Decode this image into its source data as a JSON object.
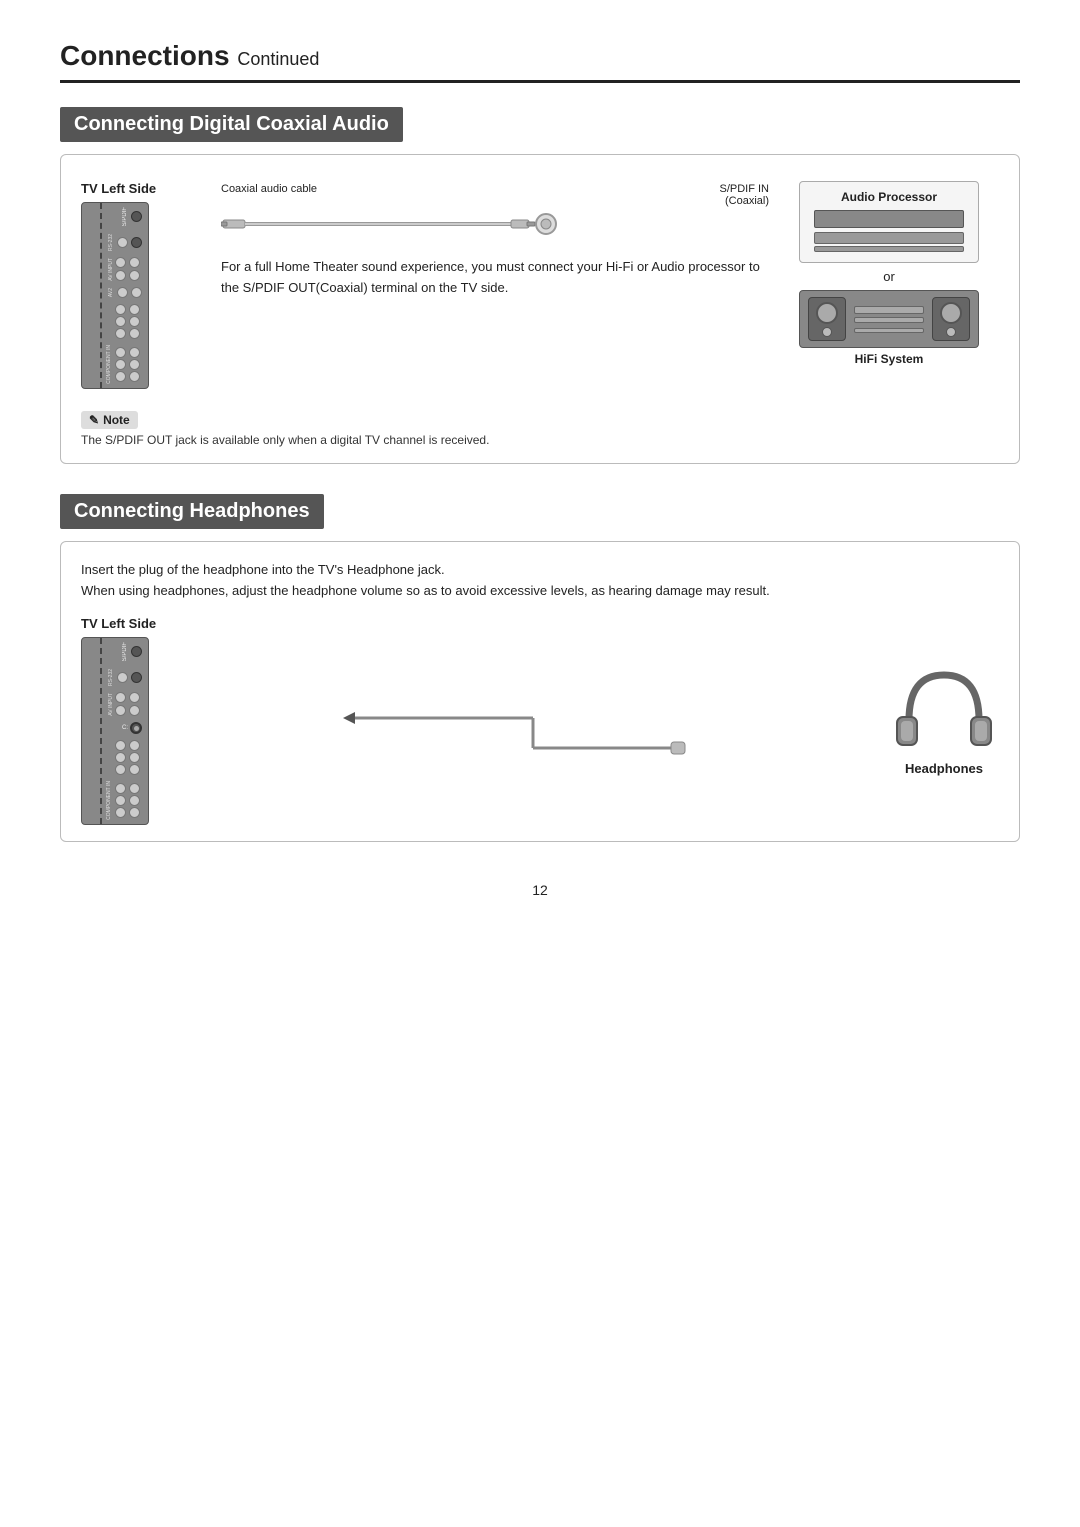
{
  "page": {
    "title": "Connections",
    "title_continued": "Continued",
    "page_number": "12"
  },
  "coaxial_section": {
    "header": "Connecting Digital Coaxial Audio",
    "tv_side_label": "TV Left Side",
    "cable_label": "Coaxial audio cable",
    "spdif_in_label": "S/PDIF IN",
    "coaxial_label": "(Coaxial)",
    "audio_processor_label": "Audio  Processor",
    "or_label": "or",
    "hifi_label": "HiFi System",
    "info_text": "For a full Home Theater sound experience, you must connect your Hi-Fi or Audio processor to the S/PDIF OUT(Coaxial) terminal on the TV side.",
    "note_label": "Note",
    "note_text": "The S/PDIF OUT jack is available only when a digital TV channel is received."
  },
  "headphones_section": {
    "header": "Connecting Headphones",
    "tv_side_label": "TV Left Side",
    "intro_line1": "Insert the plug of the headphone into the TV's Headphone jack.",
    "intro_line2": "When using headphones, adjust the headphone volume so as to avoid excessive levels, as hearing damage may result.",
    "headphones_label": "Headphones"
  }
}
